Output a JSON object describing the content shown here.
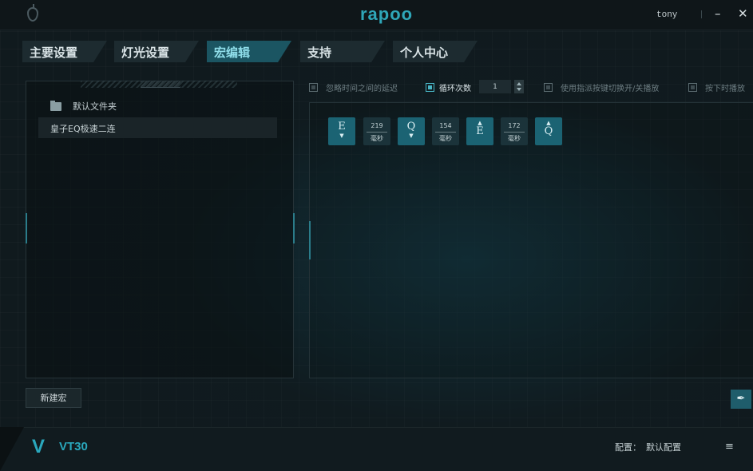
{
  "window": {
    "logo": "rapoo",
    "username": "tony",
    "minimize_glyph": "–",
    "close_glyph": "✕",
    "app_icon": "mouse-icon"
  },
  "tabs": [
    {
      "label": "主要设置",
      "active": false
    },
    {
      "label": "灯光设置",
      "active": false
    },
    {
      "label": "宏编辑",
      "active": true
    },
    {
      "label": "支持",
      "active": false
    },
    {
      "label": "个人中心",
      "active": false
    }
  ],
  "macro_list": {
    "folder_label": "默认文件夹",
    "items": [
      "皇子EQ极速二连"
    ]
  },
  "new_macro_label": "新建宏",
  "options": {
    "ignore_delay": {
      "label": "忽略时间之间的延迟",
      "checked": false
    },
    "loop_count": {
      "label": "循环次数",
      "checked": true,
      "value": "1"
    },
    "toggle_by_key": {
      "label": "使用指派按键切换开/关播放",
      "checked": false
    },
    "play_while_pressed": {
      "label": "按下时播放",
      "checked": false
    }
  },
  "steps": [
    {
      "type": "key",
      "key": "E",
      "dir": "down",
      "arrow": "▼"
    },
    {
      "type": "delay",
      "value": "219",
      "unit": "毫秒"
    },
    {
      "type": "key",
      "key": "Q",
      "dir": "down",
      "arrow": "▼"
    },
    {
      "type": "delay",
      "value": "154",
      "unit": "毫秒"
    },
    {
      "type": "key",
      "key": "E",
      "dir": "up",
      "arrow": "▲"
    },
    {
      "type": "delay",
      "value": "172",
      "unit": "毫秒"
    },
    {
      "type": "key",
      "key": "Q",
      "dir": "up",
      "arrow": "▲"
    }
  ],
  "clear_icon": "broom-icon",
  "footer": {
    "logo": "V",
    "model": "VT30",
    "config_label": "配置：",
    "config_value": "默认配置",
    "menu_glyph": "≡"
  },
  "colors": {
    "accent": "#2aa8bd",
    "active_tab": "#1b5562",
    "key_step": "#1b6373"
  }
}
